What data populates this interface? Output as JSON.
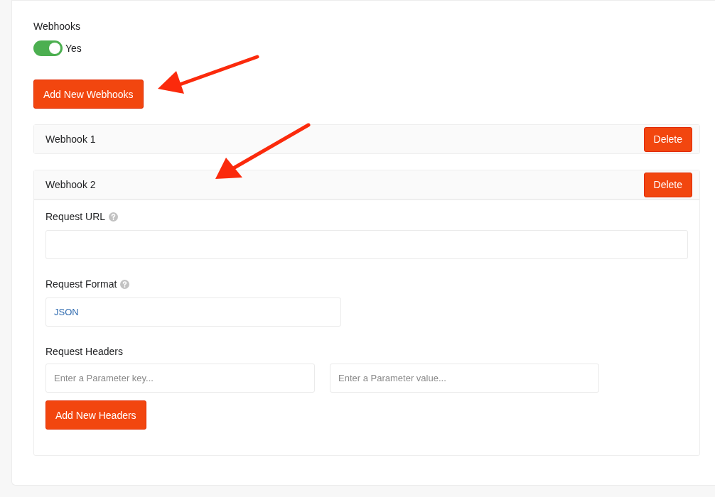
{
  "webhooks_setting": {
    "label": "Webhooks",
    "toggle": {
      "on": true,
      "label": "Yes"
    }
  },
  "add_button": "Add New Webhooks",
  "webhooks": [
    {
      "title": "Webhook 1",
      "expanded": false,
      "delete_button": "Delete"
    },
    {
      "title": "Webhook 2",
      "expanded": true,
      "delete_button": "Delete",
      "request_url": {
        "label": "Request URL"
      },
      "request_format": {
        "label": "Request Format",
        "value": "JSON"
      },
      "request_headers": {
        "label": "Request Headers",
        "key_placeholder": "Enter a Parameter key...",
        "value_placeholder": "Enter a Parameter value...",
        "add_button": "Add New Headers"
      }
    }
  ]
}
